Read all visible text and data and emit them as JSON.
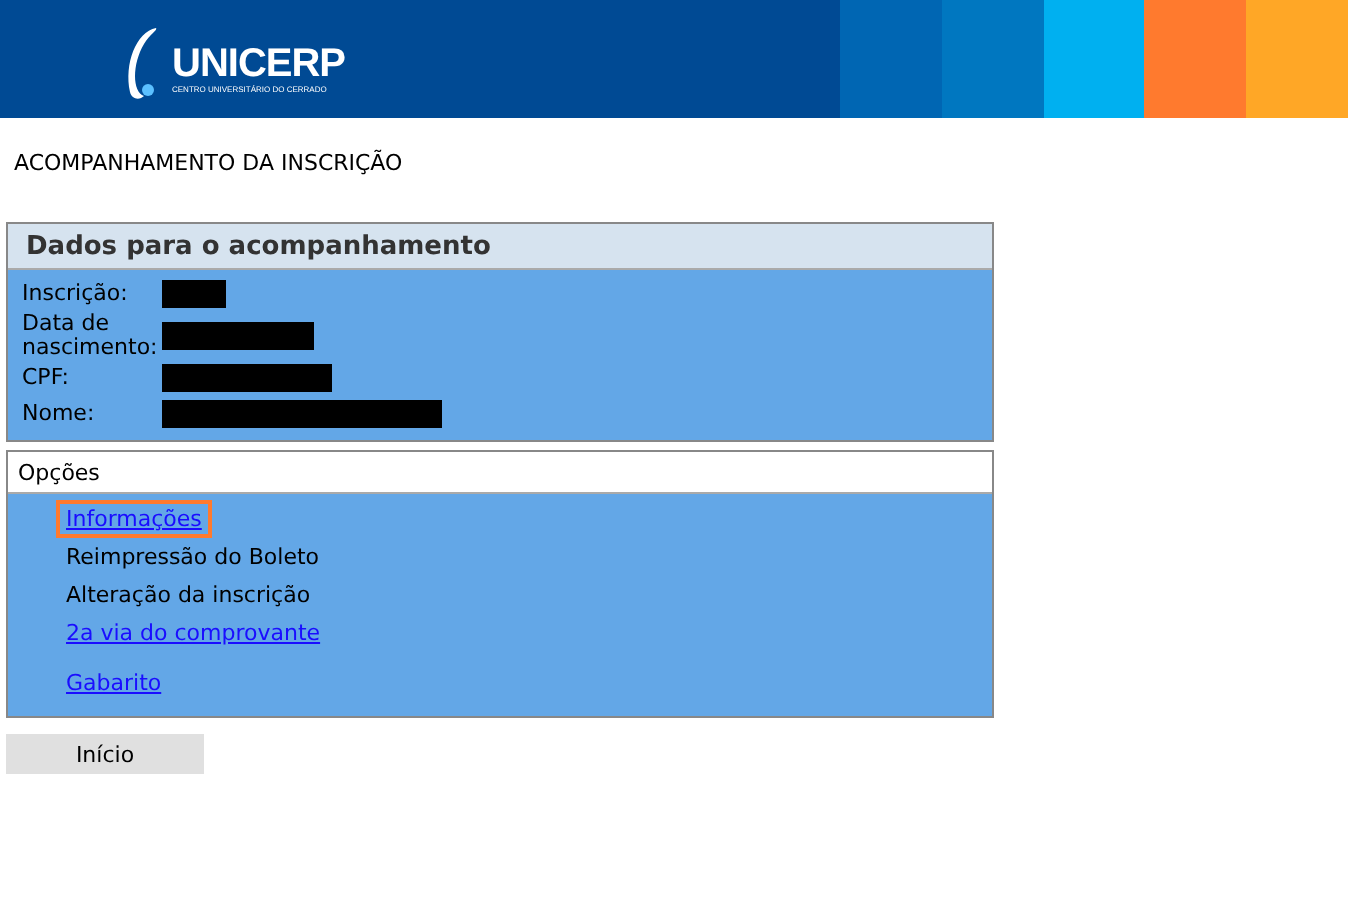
{
  "header": {
    "logo_text": "UNICERP",
    "logo_subtitle": "CENTRO UNIVERSITÁRIO DO CERRADO"
  },
  "page_title": "ACOMPANHAMENTO DA INSCRIÇÃO",
  "details": {
    "title": "Dados para o acompanhamento",
    "fields": [
      {
        "label": "Inscrição:"
      },
      {
        "label": "Data de nascimento:"
      },
      {
        "label": "CPF:"
      },
      {
        "label": "Nome:"
      }
    ]
  },
  "options": {
    "title": "Opções",
    "items": [
      {
        "label": "Informações",
        "kind": "link",
        "selected": true
      },
      {
        "label": "Reimpressão do Boleto",
        "kind": "text",
        "selected": false
      },
      {
        "label": "Alteração da inscrição",
        "kind": "text",
        "selected": false
      },
      {
        "label": "2a via do comprovante",
        "kind": "link",
        "selected": false
      },
      {
        "label": "Gabarito",
        "kind": "link",
        "selected": false
      }
    ]
  },
  "home_button": "Início"
}
